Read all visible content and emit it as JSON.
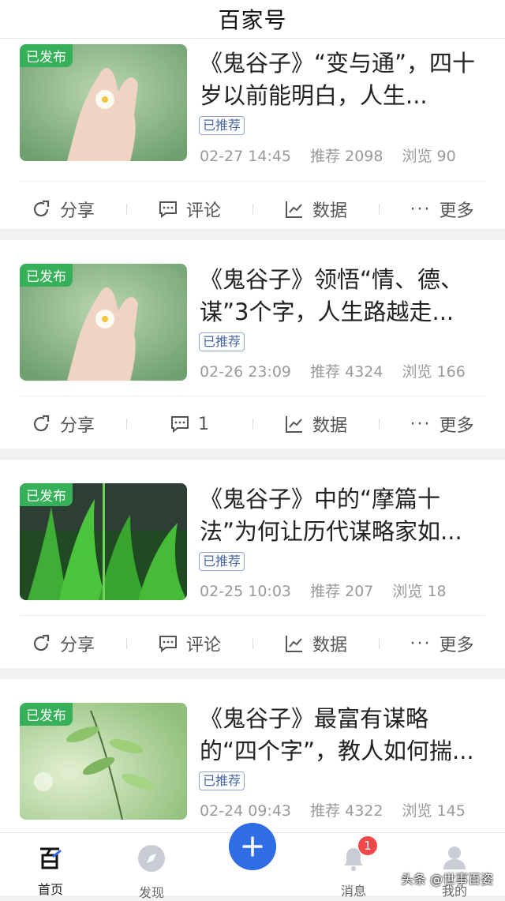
{
  "header": {
    "title": "百家号"
  },
  "articles": [
    {
      "badge": "已发布",
      "title": "《鬼谷子》“变与通”，四十岁以前能明白，人生...",
      "tag": "已推荐",
      "date": "02-27 14:45",
      "recommend": "推荐 2098",
      "views": "浏览 90",
      "comment_label": "评论",
      "image": "hand-with-flower"
    },
    {
      "badge": "已发布",
      "title": "《鬼谷子》领悟“情、德、谋”3个字，人生路越走...",
      "tag": "已推荐",
      "date": "02-26 23:09",
      "recommend": "推荐 4324",
      "views": "浏览 166",
      "comment_label": "1",
      "image": "hand-with-flower"
    },
    {
      "badge": "已发布",
      "title": "《鬼谷子》中的“摩篇十法”为何让历代谋略家如...",
      "tag": "已推荐",
      "date": "02-25 10:03",
      "recommend": "推荐 207",
      "views": "浏览 18",
      "comment_label": "评论",
      "image": "green-aquatic-plants"
    },
    {
      "badge": "已发布",
      "title": "《鬼谷子》最富有谋略的“四个字”，教人如何揣...",
      "tag": "已推荐",
      "date": "02-24 09:43",
      "recommend": "推荐 4322",
      "views": "浏览 145",
      "comment_label": "评论",
      "image": "green-leaves-bokeh"
    }
  ],
  "actions": {
    "share": "分享",
    "data": "数据",
    "more": "更多"
  },
  "nav": {
    "home": "首页",
    "discover": "发现",
    "messages": "消息",
    "mine": "我的",
    "messages_badge": "1"
  },
  "watermark": "头条 @世事百姿",
  "colors": {
    "accent": "#2f6de6",
    "published_badge": "#37b05a",
    "notification": "#f04848"
  }
}
